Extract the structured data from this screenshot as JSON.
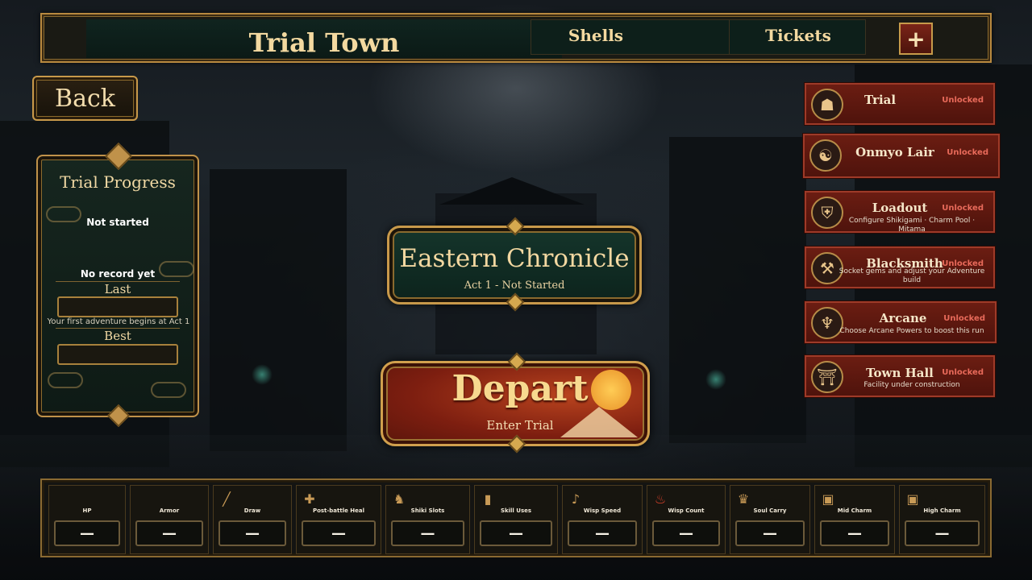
{
  "header": {
    "title": "Trial Town",
    "shells_label": "Shells",
    "tickets_label": "Tickets",
    "add_button": "+"
  },
  "back_button": "Back",
  "progress": {
    "title": "Trial Progress",
    "status": "Not started",
    "no_record": "No record yet",
    "last_label": "Last",
    "best_label": "Best",
    "note": "Your first adventure begins at Act 1"
  },
  "chronicle": {
    "title": "Eastern Chronicle",
    "subtitle": "Act 1 - Not Started"
  },
  "depart": {
    "title": "Depart",
    "subtitle": "Enter Trial"
  },
  "menu": [
    {
      "label": "Trial",
      "status": "Unlocked",
      "desc": "",
      "icon": "demon-mask-icon"
    },
    {
      "label": "Onmyo Lair",
      "status": "Unlocked",
      "desc": "",
      "icon": "yin-yang-icon"
    },
    {
      "label": "Loadout",
      "status": "Unlocked",
      "desc": "Configure Shikigami · Charm Pool · Mitama",
      "icon": "armor-icon"
    },
    {
      "label": "Blacksmith",
      "status": "Unlocked",
      "desc": "Socket gems and adjust your Adventure build",
      "icon": "anvil-icon"
    },
    {
      "label": "Arcane",
      "status": "Unlocked",
      "desc": "Choose Arcane Powers to boost this run",
      "icon": "flame-icon"
    },
    {
      "label": "Town Hall",
      "status": "Unlocked",
      "desc": "Facility under construction",
      "icon": "pagoda-icon"
    }
  ],
  "stats": [
    {
      "label": "HP",
      "value": "—",
      "icon": ""
    },
    {
      "label": "Armor",
      "value": "—",
      "icon": ""
    },
    {
      "label": "Draw",
      "value": "—",
      "icon": "card-icon"
    },
    {
      "label": "Post-battle Heal",
      "value": "—",
      "icon": "cross-icon"
    },
    {
      "label": "Shiki Slots",
      "value": "—",
      "icon": "shiki-icon"
    },
    {
      "label": "Skill Uses",
      "value": "—",
      "icon": "scroll-icon"
    },
    {
      "label": "Wisp Speed",
      "value": "—",
      "icon": "wisp-icon"
    },
    {
      "label": "Wisp Count",
      "value": "—",
      "icon": "fire-icon"
    },
    {
      "label": "Soul Carry",
      "value": "—",
      "icon": "soul-icon"
    },
    {
      "label": "Mid Charm",
      "value": "—",
      "icon": "charm-icon"
    },
    {
      "label": "High Charm",
      "value": "—",
      "icon": "charm-icon"
    }
  ],
  "colors": {
    "gold": "#c8994a",
    "menu_red": "#6b1d12",
    "status_red": "#e86a5a",
    "panel_green": "#15352b"
  }
}
